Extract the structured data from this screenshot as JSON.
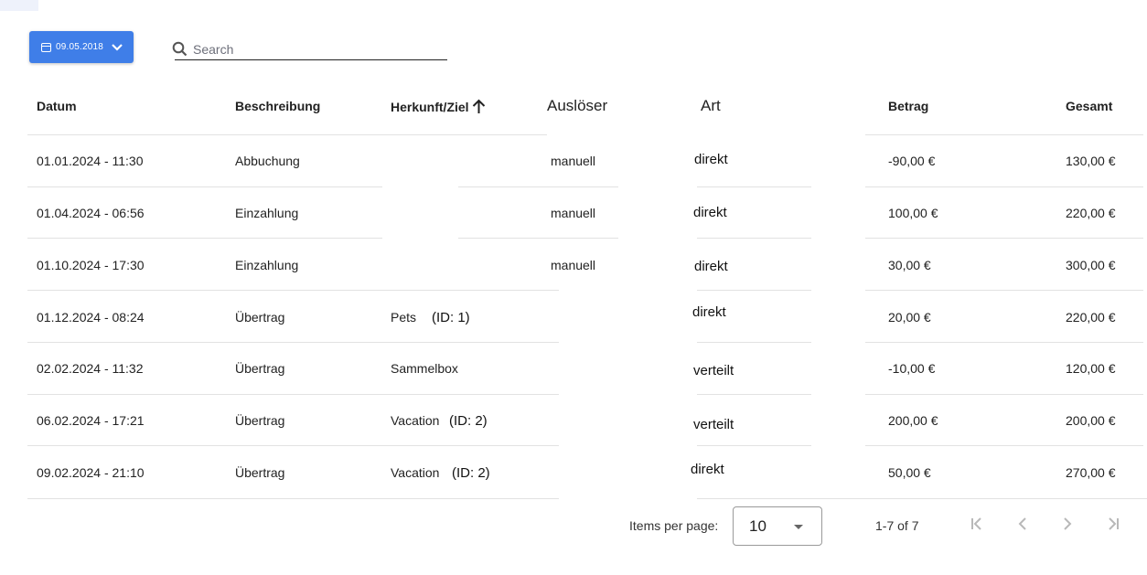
{
  "toolbar": {
    "date_label": "09.05.2018",
    "search_placeholder": "Search"
  },
  "table": {
    "columns": [
      "Datum",
      "Beschreibung",
      "Herkunft/Ziel",
      "Auslöser",
      "Art",
      "Betrag",
      "Gesamt"
    ],
    "sorted_column": "Herkunft/Ziel",
    "sort_direction": "ascending",
    "rows": [
      {
        "datum": "01.01.2024 - 11:30",
        "beschreibung": "Abbuchung",
        "ziel": "",
        "ziel_id": "",
        "ausloeser": "manuell",
        "art": "direkt",
        "betrag": "-90,00 €",
        "gesamt": "130,00 €"
      },
      {
        "datum": "01.04.2024 - 06:56",
        "beschreibung": "Einzahlung",
        "ziel": "",
        "ziel_id": "",
        "ausloeser": "manuell",
        "art": "direkt",
        "betrag": "100,00 €",
        "gesamt": "220,00 €"
      },
      {
        "datum": "01.10.2024 - 17:30",
        "beschreibung": "Einzahlung",
        "ziel": "",
        "ziel_id": "",
        "ausloeser": "manuell",
        "art": "direkt",
        "betrag": "30,00 €",
        "gesamt": "300,00 €"
      },
      {
        "datum": "01.12.2024 - 08:24",
        "beschreibung": "Übertrag",
        "ziel": "Pets",
        "ziel_id": "(ID: 1)",
        "ausloeser": "",
        "art": "direkt",
        "betrag": "20,00 €",
        "gesamt": "220,00 €"
      },
      {
        "datum": "02.02.2024 - 11:32",
        "beschreibung": "Übertrag",
        "ziel": "Sammelbox",
        "ziel_id": "",
        "ausloeser": "",
        "art": "verteilt",
        "betrag": "-10,00 €",
        "gesamt": "120,00 €"
      },
      {
        "datum": "06.02.2024 - 17:21",
        "beschreibung": "Übertrag",
        "ziel": "Vacation",
        "ziel_id": "(ID: 2)",
        "ausloeser": "",
        "art": "verteilt",
        "betrag": "200,00 €",
        "gesamt": "200,00 €"
      },
      {
        "datum": "09.02.2024 - 21:10",
        "beschreibung": "Übertrag",
        "ziel": "Vacation",
        "ziel_id": "(ID: 2)",
        "ausloeser": "",
        "art": "direkt",
        "betrag": "50,00 €",
        "gesamt": "270,00 €"
      }
    ]
  },
  "paginator": {
    "items_per_page_label": "Items per page:",
    "page_size": "10",
    "range_label": "1-7 of 7"
  },
  "icons": {
    "date": "calendar-icon",
    "date_chevron": "chevron-down-icon",
    "search": "search-icon",
    "sort": "arrow-up-icon",
    "first": "first-page-icon",
    "prev": "chevron-left-icon",
    "next": "chevron-right-icon",
    "last": "last-page-icon"
  },
  "colors": {
    "accent": "#3f7ee8",
    "disabled_icon": "#b8b8b8"
  }
}
